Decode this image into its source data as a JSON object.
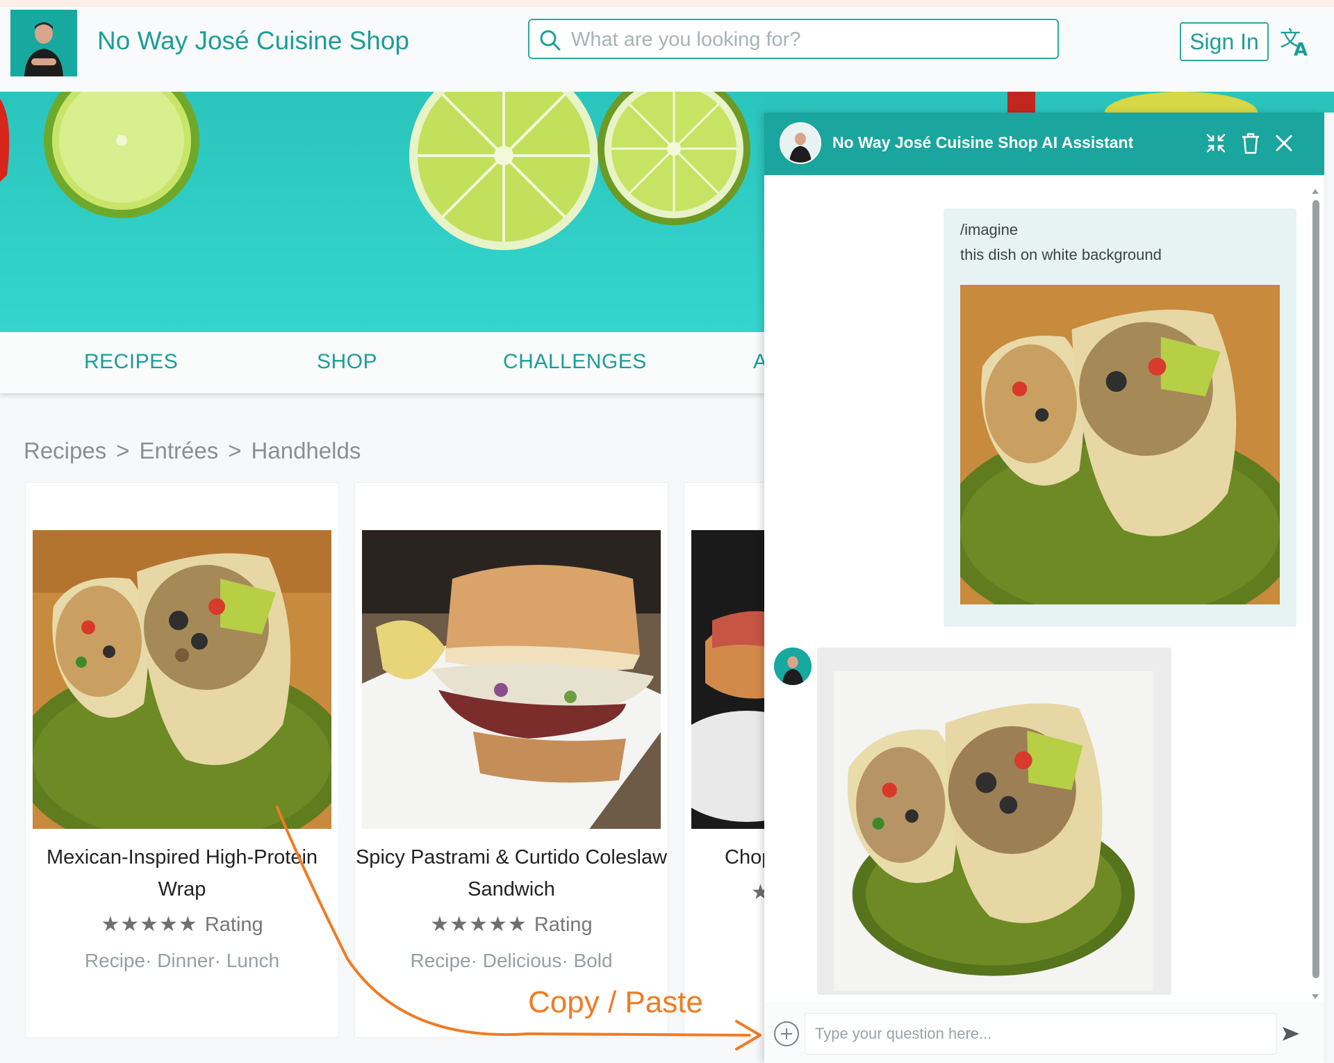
{
  "header": {
    "shop_name": "No Way José Cuisine Shop",
    "search_placeholder": "What are you looking for?",
    "sign_in": "Sign In",
    "translate_icon": "translate-icon"
  },
  "nav": {
    "tabs": [
      {
        "label": "RECIPES"
      },
      {
        "label": "SHOP"
      },
      {
        "label": "CHALLENGES"
      },
      {
        "label": "A"
      }
    ]
  },
  "breadcrumb": {
    "items": [
      "Recipes",
      "Entrées",
      "Handhelds"
    ],
    "separator": ">"
  },
  "cards": [
    {
      "title": "Mexican-Inspired High-Protein Wrap",
      "rating_label": "Rating",
      "stars": "★★★★★",
      "tags": [
        "Recipe",
        "Dinner",
        "Lunch"
      ],
      "tag_sep": "·"
    },
    {
      "title": "Spicy Pastrami & Curtido Coleslaw Sandwich",
      "rating_label": "Rating",
      "stars": "★★★★★",
      "tags": [
        "Recipe",
        "Delicious",
        "Bold"
      ],
      "tag_sep": "·"
    },
    {
      "title": "Chop",
      "stars": "★"
    }
  ],
  "annotation": {
    "label": "Copy / Paste",
    "color": "#f07b23"
  },
  "chat": {
    "title": "No Way José Cuisine Shop AI Assistant",
    "header_icons": [
      "collapse-icon",
      "trash-icon",
      "close-icon"
    ],
    "user_message": {
      "command": "/imagine",
      "text": "this dish on white background"
    },
    "input_placeholder": "Type your question here...",
    "accent": "#1aa59e"
  }
}
